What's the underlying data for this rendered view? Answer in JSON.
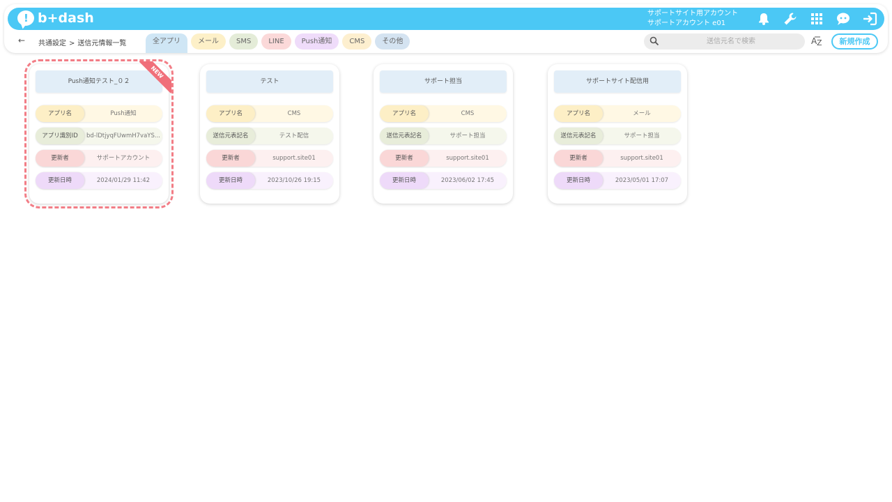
{
  "app": {
    "logo_mark": "!",
    "logo_text": "b+dash"
  },
  "header": {
    "account_line1": "サポートサイト用アカウント",
    "account_line2": "サポートアカウント e01",
    "icons": [
      "bell-icon",
      "wrench-icon",
      "grid-icon",
      "chat-bot-icon",
      "logout-icon"
    ]
  },
  "subbar": {
    "back": "←",
    "breadcrumb": [
      "共通設定",
      "送信元情報一覧"
    ],
    "breadcrumb_sep": ">",
    "tabs": [
      {
        "label": "全アプリ",
        "color": "#cfe6f5",
        "active": true
      },
      {
        "label": "メール",
        "color": "#fdf0c8"
      },
      {
        "label": "SMS",
        "color": "#e4ecd8"
      },
      {
        "label": "LINE",
        "color": "#fbd9d9"
      },
      {
        "label": "Push通知",
        "color": "#efdcfa"
      },
      {
        "label": "CMS",
        "color": "#fdefcf"
      },
      {
        "label": "その他",
        "color": "#d4e3f1"
      }
    ],
    "search_placeholder": "送信元名で検索",
    "sort_label": "A-Z",
    "new_button": "新規作成"
  },
  "cards": [
    {
      "title": "Push通知テスト_０２",
      "badge": "NEW",
      "rows": [
        {
          "label": "アプリ名",
          "value": "Push通知"
        },
        {
          "label": "アプリ識別ID",
          "value": "bd-lDtjyqFUwmH7vaYS..."
        },
        {
          "label": "更新者",
          "value": "サポートアカウント"
        },
        {
          "label": "更新日時",
          "value": "2024/01/29 11:42"
        }
      ]
    },
    {
      "title": "テスト",
      "rows": [
        {
          "label": "アプリ名",
          "value": "CMS"
        },
        {
          "label": "送信元表記名",
          "value": "テスト配信"
        },
        {
          "label": "更新者",
          "value": "support.site01"
        },
        {
          "label": "更新日時",
          "value": "2023/10/26 19:15"
        }
      ]
    },
    {
      "title": "サポート担当",
      "rows": [
        {
          "label": "アプリ名",
          "value": "CMS"
        },
        {
          "label": "送信元表記名",
          "value": "サポート担当"
        },
        {
          "label": "更新者",
          "value": "support.site01"
        },
        {
          "label": "更新日時",
          "value": "2023/06/02 17:45"
        }
      ]
    },
    {
      "title": "サポートサイト配信用",
      "rows": [
        {
          "label": "アプリ名",
          "value": "メール"
        },
        {
          "label": "送信元表記名",
          "value": "サポート担当"
        },
        {
          "label": "更新者",
          "value": "support.site01"
        },
        {
          "label": "更新日時",
          "value": "2023/05/01 17:07"
        }
      ]
    }
  ],
  "colors": {
    "brand": "#4bc8f5",
    "new_highlight": "#f27d86"
  }
}
